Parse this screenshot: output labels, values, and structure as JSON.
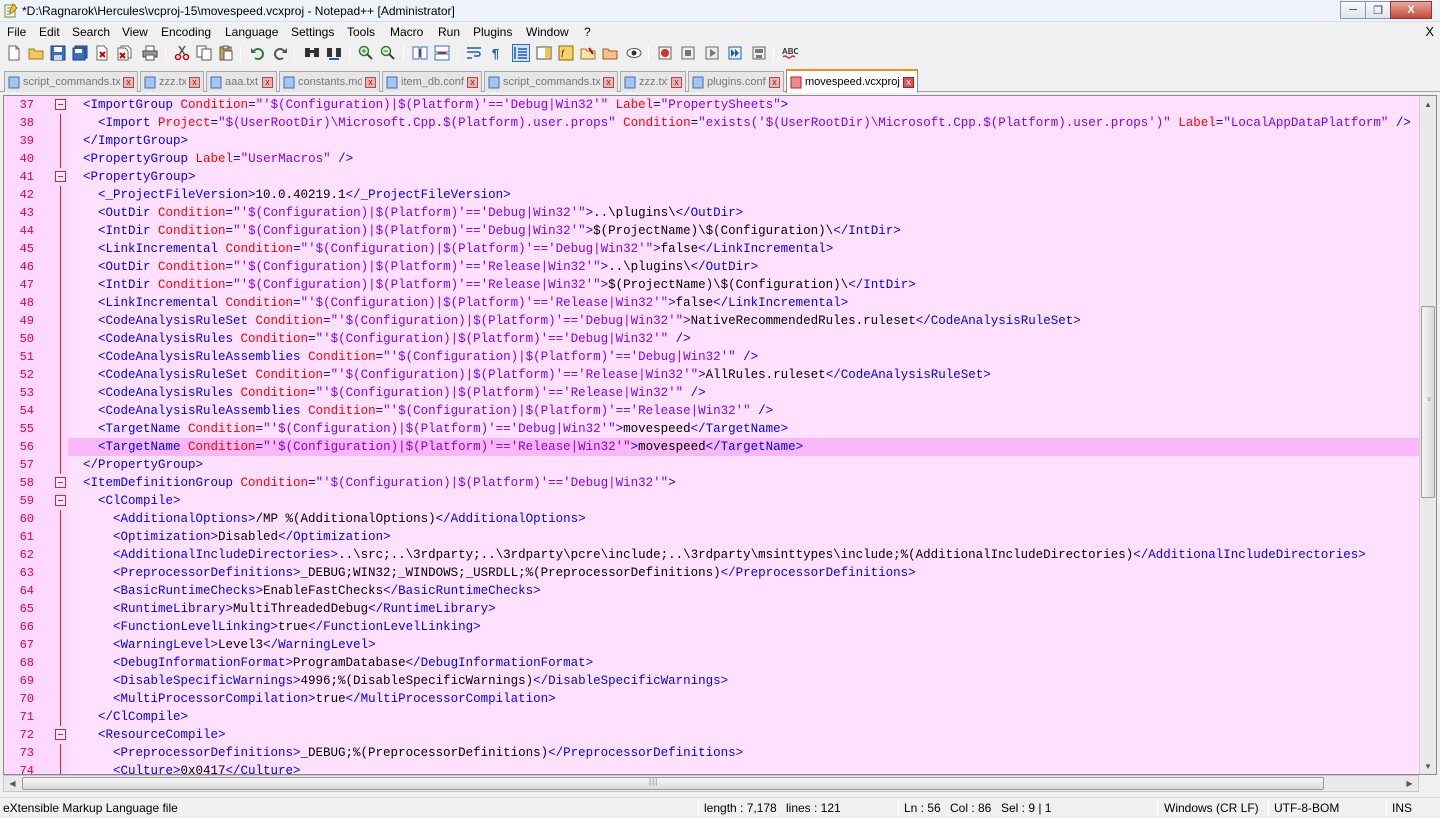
{
  "window": {
    "title": "*D:\\Ragnarok\\Hercules\\vcproj-15\\movespeed.vcxproj - Notepad++ [Administrator]",
    "minimize": "─",
    "maximize": "❐",
    "close": "X"
  },
  "menu": {
    "items": [
      "File",
      "Edit",
      "Search",
      "View",
      "Encoding",
      "Language",
      "Settings",
      "Tools",
      "Macro",
      "Run",
      "Plugins",
      "Window",
      "?"
    ],
    "close_label": "X"
  },
  "toolbar": {
    "buttons": [
      "new-file-icon",
      "open-file-icon",
      "save-icon",
      "save-all-icon",
      "close-icon",
      "close-all-icon",
      "print-icon",
      "cut-icon",
      "copy-icon",
      "paste-icon",
      "undo-icon",
      "redo-icon",
      "find-icon",
      "replace-icon",
      "zoom-in-icon",
      "zoom-out-icon",
      "sync-v-icon",
      "sync-h-icon",
      "word-wrap-icon",
      "show-all-chars-icon",
      "indent-guide-icon",
      "doc-map-icon",
      "function-list-icon",
      "folder-workspace-icon",
      "monitoring-icon",
      "record-macro-icon",
      "stop-record-icon",
      "playback-macro-icon",
      "run-macro-multiple-icon",
      "save-macro-icon",
      "spell-check-icon"
    ],
    "spell_label": "ABC"
  },
  "tabs": [
    {
      "label": "script_commands.txt",
      "active": false
    },
    {
      "label": "zzz.txt",
      "active": false
    },
    {
      "label": "aaa.txt",
      "active": false
    },
    {
      "label": "constants.md",
      "active": false
    },
    {
      "label": "item_db.conf",
      "active": false
    },
    {
      "label": "script_commands.txt",
      "active": false
    },
    {
      "label": "zzz.txt",
      "active": false
    },
    {
      "label": "plugins.conf",
      "active": false
    },
    {
      "label": "movespeed.vcxproj",
      "active": true
    }
  ],
  "tab_close": "x",
  "editor": {
    "current_line": 56,
    "lines": [
      {
        "n": "37",
        "indent": 1,
        "fold": "open",
        "tokens": [
          [
            "tg",
            "<ImportGroup "
          ],
          [
            "an",
            "Condition"
          ],
          [
            "tg",
            "="
          ],
          [
            "av",
            "\"'$(Configuration)|$(Platform)'=='Debug|Win32'\""
          ],
          [
            "tg",
            " "
          ],
          [
            "an",
            "Label"
          ],
          [
            "tg",
            "="
          ],
          [
            "av",
            "\"PropertySheets\""
          ],
          [
            "tg",
            ">"
          ]
        ]
      },
      {
        "n": "38",
        "indent": 2,
        "tokens": [
          [
            "tg",
            "<Import "
          ],
          [
            "an",
            "Project"
          ],
          [
            "tg",
            "="
          ],
          [
            "av",
            "\"$(UserRootDir)\\Microsoft.Cpp.$(Platform).user.props\""
          ],
          [
            "tg",
            " "
          ],
          [
            "an",
            "Condition"
          ],
          [
            "tg",
            "="
          ],
          [
            "av",
            "\"exists('$(UserRootDir)\\Microsoft.Cpp.$(Platform).user.props')\""
          ],
          [
            "tg",
            " "
          ],
          [
            "an",
            "Label"
          ],
          [
            "tg",
            "="
          ],
          [
            "av",
            "\"LocalAppDataPlatform\""
          ],
          [
            "tg",
            " />"
          ]
        ]
      },
      {
        "n": "39",
        "indent": 1,
        "tokens": [
          [
            "tg",
            "</ImportGroup>"
          ]
        ]
      },
      {
        "n": "40",
        "indent": 1,
        "tokens": [
          [
            "tg",
            "<PropertyGroup "
          ],
          [
            "an",
            "Label"
          ],
          [
            "tg",
            "="
          ],
          [
            "av",
            "\"UserMacros\""
          ],
          [
            "tg",
            " />"
          ]
        ]
      },
      {
        "n": "41",
        "indent": 1,
        "fold": "open",
        "tokens": [
          [
            "tg",
            "<PropertyGroup>"
          ]
        ]
      },
      {
        "n": "42",
        "indent": 2,
        "tokens": [
          [
            "tg",
            "<_ProjectFileVersion>"
          ],
          [
            "tx",
            "10.0.40219.1"
          ],
          [
            "tg",
            "</_ProjectFileVersion>"
          ]
        ]
      },
      {
        "n": "43",
        "indent": 2,
        "tokens": [
          [
            "tg",
            "<OutDir "
          ],
          [
            "an",
            "Condition"
          ],
          [
            "tg",
            "="
          ],
          [
            "av",
            "\"'$(Configuration)|$(Platform)'=='Debug|Win32'\""
          ],
          [
            "tg",
            ">"
          ],
          [
            "tx",
            "..\\plugins\\"
          ],
          [
            "tg",
            "</OutDir>"
          ]
        ]
      },
      {
        "n": "44",
        "indent": 2,
        "tokens": [
          [
            "tg",
            "<IntDir "
          ],
          [
            "an",
            "Condition"
          ],
          [
            "tg",
            "="
          ],
          [
            "av",
            "\"'$(Configuration)|$(Platform)'=='Debug|Win32'\""
          ],
          [
            "tg",
            ">"
          ],
          [
            "tx",
            "$(ProjectName)\\$(Configuration)\\"
          ],
          [
            "tg",
            "</IntDir>"
          ]
        ]
      },
      {
        "n": "45",
        "indent": 2,
        "tokens": [
          [
            "tg",
            "<LinkIncremental "
          ],
          [
            "an",
            "Condition"
          ],
          [
            "tg",
            "="
          ],
          [
            "av",
            "\"'$(Configuration)|$(Platform)'=='Debug|Win32'\""
          ],
          [
            "tg",
            ">"
          ],
          [
            "tx",
            "false"
          ],
          [
            "tg",
            "</LinkIncremental>"
          ]
        ]
      },
      {
        "n": "46",
        "indent": 2,
        "tokens": [
          [
            "tg",
            "<OutDir "
          ],
          [
            "an",
            "Condition"
          ],
          [
            "tg",
            "="
          ],
          [
            "av",
            "\"'$(Configuration)|$(Platform)'=='Release|Win32'\""
          ],
          [
            "tg",
            ">"
          ],
          [
            "tx",
            "..\\plugins\\"
          ],
          [
            "tg",
            "</OutDir>"
          ]
        ]
      },
      {
        "n": "47",
        "indent": 2,
        "tokens": [
          [
            "tg",
            "<IntDir "
          ],
          [
            "an",
            "Condition"
          ],
          [
            "tg",
            "="
          ],
          [
            "av",
            "\"'$(Configuration)|$(Platform)'=='Release|Win32'\""
          ],
          [
            "tg",
            ">"
          ],
          [
            "tx",
            "$(ProjectName)\\$(Configuration)\\"
          ],
          [
            "tg",
            "</IntDir>"
          ]
        ]
      },
      {
        "n": "48",
        "indent": 2,
        "tokens": [
          [
            "tg",
            "<LinkIncremental "
          ],
          [
            "an",
            "Condition"
          ],
          [
            "tg",
            "="
          ],
          [
            "av",
            "\"'$(Configuration)|$(Platform)'=='Release|Win32'\""
          ],
          [
            "tg",
            ">"
          ],
          [
            "tx",
            "false"
          ],
          [
            "tg",
            "</LinkIncremental>"
          ]
        ]
      },
      {
        "n": "49",
        "indent": 2,
        "tokens": [
          [
            "tg",
            "<CodeAnalysisRuleSet "
          ],
          [
            "an",
            "Condition"
          ],
          [
            "tg",
            "="
          ],
          [
            "av",
            "\"'$(Configuration)|$(Platform)'=='Debug|Win32'\""
          ],
          [
            "tg",
            ">"
          ],
          [
            "tx",
            "NativeRecommendedRules.ruleset"
          ],
          [
            "tg",
            "</CodeAnalysisRuleSet>"
          ]
        ]
      },
      {
        "n": "50",
        "indent": 2,
        "tokens": [
          [
            "tg",
            "<CodeAnalysisRules "
          ],
          [
            "an",
            "Condition"
          ],
          [
            "tg",
            "="
          ],
          [
            "av",
            "\"'$(Configuration)|$(Platform)'=='Debug|Win32'\""
          ],
          [
            "tg",
            " />"
          ]
        ]
      },
      {
        "n": "51",
        "indent": 2,
        "tokens": [
          [
            "tg",
            "<CodeAnalysisRuleAssemblies "
          ],
          [
            "an",
            "Condition"
          ],
          [
            "tg",
            "="
          ],
          [
            "av",
            "\"'$(Configuration)|$(Platform)'=='Debug|Win32'\""
          ],
          [
            "tg",
            " />"
          ]
        ]
      },
      {
        "n": "52",
        "indent": 2,
        "tokens": [
          [
            "tg",
            "<CodeAnalysisRuleSet "
          ],
          [
            "an",
            "Condition"
          ],
          [
            "tg",
            "="
          ],
          [
            "av",
            "\"'$(Configuration)|$(Platform)'=='Release|Win32'\""
          ],
          [
            "tg",
            ">"
          ],
          [
            "tx",
            "AllRules.ruleset"
          ],
          [
            "tg",
            "</CodeAnalysisRuleSet>"
          ]
        ]
      },
      {
        "n": "53",
        "indent": 2,
        "tokens": [
          [
            "tg",
            "<CodeAnalysisRules "
          ],
          [
            "an",
            "Condition"
          ],
          [
            "tg",
            "="
          ],
          [
            "av",
            "\"'$(Configuration)|$(Platform)'=='Release|Win32'\""
          ],
          [
            "tg",
            " />"
          ]
        ]
      },
      {
        "n": "54",
        "indent": 2,
        "tokens": [
          [
            "tg",
            "<CodeAnalysisRuleAssemblies "
          ],
          [
            "an",
            "Condition"
          ],
          [
            "tg",
            "="
          ],
          [
            "av",
            "\"'$(Configuration)|$(Platform)'=='Release|Win32'\""
          ],
          [
            "tg",
            " />"
          ]
        ]
      },
      {
        "n": "55",
        "indent": 2,
        "tokens": [
          [
            "tg",
            "<TargetName "
          ],
          [
            "an",
            "Condition"
          ],
          [
            "tg",
            "="
          ],
          [
            "av",
            "\"'$(Configuration)|$(Platform)'=='Debug|Win32'\""
          ],
          [
            "tg",
            ">"
          ],
          [
            "tx",
            "movespeed"
          ],
          [
            "tg",
            "</TargetName>"
          ]
        ]
      },
      {
        "n": "56",
        "indent": 2,
        "tokens": [
          [
            "tg",
            "<TargetName "
          ],
          [
            "an",
            "Condition"
          ],
          [
            "tg",
            "="
          ],
          [
            "av",
            "\"'$(Configuration)|$(Platform)'=='Release|Win32'\""
          ],
          [
            "tg",
            ">"
          ],
          [
            "tx",
            "movespeed"
          ],
          [
            "tg",
            "</TargetName>"
          ]
        ]
      },
      {
        "n": "57",
        "indent": 1,
        "tokens": [
          [
            "tg",
            "</PropertyGroup>"
          ]
        ]
      },
      {
        "n": "58",
        "indent": 1,
        "fold": "open",
        "tokens": [
          [
            "tg",
            "<ItemDefinitionGroup "
          ],
          [
            "an",
            "Condition"
          ],
          [
            "tg",
            "="
          ],
          [
            "av",
            "\"'$(Configuration)|$(Platform)'=='Debug|Win32'\""
          ],
          [
            "tg",
            ">"
          ]
        ]
      },
      {
        "n": "59",
        "indent": 2,
        "fold": "open",
        "tokens": [
          [
            "tg",
            "<ClCompile>"
          ]
        ]
      },
      {
        "n": "60",
        "indent": 3,
        "tokens": [
          [
            "tg",
            "<AdditionalOptions>"
          ],
          [
            "tx",
            "/MP %(AdditionalOptions)"
          ],
          [
            "tg",
            "</AdditionalOptions>"
          ]
        ]
      },
      {
        "n": "61",
        "indent": 3,
        "tokens": [
          [
            "tg",
            "<Optimization>"
          ],
          [
            "tx",
            "Disabled"
          ],
          [
            "tg",
            "</Optimization>"
          ]
        ]
      },
      {
        "n": "62",
        "indent": 3,
        "tokens": [
          [
            "tg",
            "<AdditionalIncludeDirectories>"
          ],
          [
            "tx",
            "..\\src;..\\3rdparty;..\\3rdparty\\pcre\\include;..\\3rdparty\\msinttypes\\include;%(AdditionalIncludeDirectories)"
          ],
          [
            "tg",
            "</AdditionalIncludeDirectories>"
          ]
        ]
      },
      {
        "n": "63",
        "indent": 3,
        "tokens": [
          [
            "tg",
            "<PreprocessorDefinitions>"
          ],
          [
            "tx",
            "_DEBUG;WIN32;_WINDOWS;_USRDLL;%(PreprocessorDefinitions)"
          ],
          [
            "tg",
            "</PreprocessorDefinitions>"
          ]
        ]
      },
      {
        "n": "64",
        "indent": 3,
        "tokens": [
          [
            "tg",
            "<BasicRuntimeChecks>"
          ],
          [
            "tx",
            "EnableFastChecks"
          ],
          [
            "tg",
            "</BasicRuntimeChecks>"
          ]
        ]
      },
      {
        "n": "65",
        "indent": 3,
        "tokens": [
          [
            "tg",
            "<RuntimeLibrary>"
          ],
          [
            "tx",
            "MultiThreadedDebug"
          ],
          [
            "tg",
            "</RuntimeLibrary>"
          ]
        ]
      },
      {
        "n": "66",
        "indent": 3,
        "tokens": [
          [
            "tg",
            "<FunctionLevelLinking>"
          ],
          [
            "tx",
            "true"
          ],
          [
            "tg",
            "</FunctionLevelLinking>"
          ]
        ]
      },
      {
        "n": "67",
        "indent": 3,
        "tokens": [
          [
            "tg",
            "<WarningLevel>"
          ],
          [
            "tx",
            "Level3"
          ],
          [
            "tg",
            "</WarningLevel>"
          ]
        ]
      },
      {
        "n": "68",
        "indent": 3,
        "tokens": [
          [
            "tg",
            "<DebugInformationFormat>"
          ],
          [
            "tx",
            "ProgramDatabase"
          ],
          [
            "tg",
            "</DebugInformationFormat>"
          ]
        ]
      },
      {
        "n": "69",
        "indent": 3,
        "tokens": [
          [
            "tg",
            "<DisableSpecificWarnings>"
          ],
          [
            "tx",
            "4996;%(DisableSpecificWarnings)"
          ],
          [
            "tg",
            "</DisableSpecificWarnings>"
          ]
        ]
      },
      {
        "n": "70",
        "indent": 3,
        "tokens": [
          [
            "tg",
            "<MultiProcessorCompilation>"
          ],
          [
            "tx",
            "true"
          ],
          [
            "tg",
            "</MultiProcessorCompilation>"
          ]
        ]
      },
      {
        "n": "71",
        "indent": 2,
        "tokens": [
          [
            "tg",
            "</ClCompile>"
          ]
        ]
      },
      {
        "n": "72",
        "indent": 2,
        "fold": "open",
        "tokens": [
          [
            "tg",
            "<ResourceCompile>"
          ]
        ]
      },
      {
        "n": "73",
        "indent": 3,
        "tokens": [
          [
            "tg",
            "<PreprocessorDefinitions>"
          ],
          [
            "tx",
            "_DEBUG;%(PreprocessorDefinitions)"
          ],
          [
            "tg",
            "</PreprocessorDefinitions>"
          ]
        ]
      },
      {
        "n": "74",
        "indent": 3,
        "tokens": [
          [
            "tg",
            "<Culture>"
          ],
          [
            "tx",
            "0x0417"
          ],
          [
            "tg",
            "</Culture>"
          ]
        ]
      }
    ]
  },
  "scrollbars": {
    "up": "▲",
    "down": "▼",
    "left": "◀",
    "right": "▶",
    "h_grip": "|||"
  },
  "status": {
    "file_type": "eXtensible Markup Language file",
    "length": "length : 7,178",
    "lines": "lines : 121",
    "ln": "Ln : 56",
    "col": "Col : 86",
    "sel": "Sel : 9 | 1",
    "eol": "Windows (CR LF)",
    "encoding": "UTF-8-BOM",
    "mode": "INS"
  },
  "colors": {
    "editor_bg": "#ffe0ff",
    "current_line_bg": "#f8b8f8",
    "tag": "#0000ff",
    "attr_name": "#ff0000",
    "attr_value": "#8000ff",
    "line_number": "#e0004f",
    "active_tab_accent": "#fa8c1e"
  }
}
